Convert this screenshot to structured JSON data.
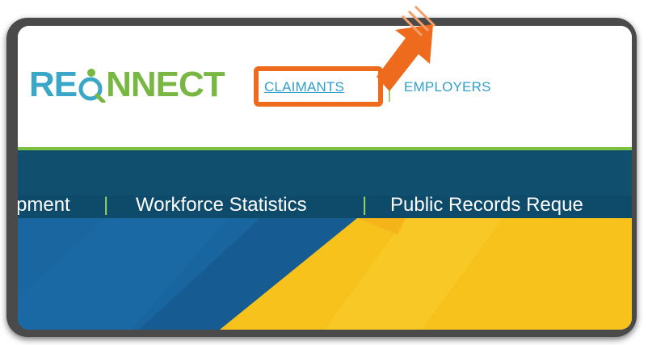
{
  "logo": {
    "part1": "RE",
    "part2": "NNECT"
  },
  "header_nav": {
    "claimants": "CLAIMANTS",
    "employers": "EMPLOYERS"
  },
  "main_nav": {
    "items": [
      "pment",
      "Workforce Statistics",
      "Public Records Reque"
    ],
    "separator": "|"
  },
  "icons": {
    "logo_icon": "person-magnifier-icon",
    "annotation": "orange-arrow-icon"
  },
  "colors": {
    "logo_blue": "#3aa7c8",
    "logo_green": "#78b842",
    "link_blue": "#2f9fd0",
    "highlight_orange": "#ee6a1c",
    "nav_bg": "#0e4a6a",
    "accent_green": "#7cc242",
    "hero_blue": "#165c93",
    "hero_yellow": "#f7c21c"
  }
}
